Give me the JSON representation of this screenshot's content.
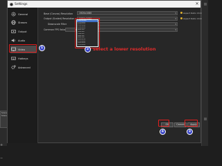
{
  "window": {
    "title": "Settings",
    "close_symbol": "×"
  },
  "sidebar": {
    "items": [
      {
        "label": "General",
        "icon": "gear-icon"
      },
      {
        "label": "Stream",
        "icon": "globe-icon"
      },
      {
        "label": "Output",
        "icon": "output-icon"
      },
      {
        "label": "Audio",
        "icon": "speaker-icon"
      },
      {
        "label": "Video",
        "icon": "monitor-icon",
        "active": true
      },
      {
        "label": "Hotkeys",
        "icon": "keyboard-icon"
      },
      {
        "label": "Advanced",
        "icon": "advanced-gear-icon"
      }
    ]
  },
  "video": {
    "base_resolution": {
      "label": "Base (Canvas) Resolution",
      "value": "1920x1080",
      "note": "Aspect Ratio 16:9"
    },
    "output_resolution": {
      "label": "Output (Scaled) Resolution",
      "value": "1920x1080",
      "note": "Aspect Ratio 16:9"
    },
    "downscale_filter": {
      "label": "Downscale Filter",
      "value": ""
    },
    "fps": {
      "label": "Common FPS Values",
      "value": ""
    },
    "resolution_options": [
      "1920x1080",
      "1536x864",
      "1280x720",
      "1152x648",
      "1096x616",
      "960x540",
      "852x480",
      "768x432",
      "698x392",
      "640x360",
      "1664x936",
      "1704x960",
      "1600x900",
      "1536x864"
    ]
  },
  "annotations": {
    "badge1": "1",
    "badge2": "2",
    "badge3": "3",
    "badge4": "4",
    "instruction": "select a lower resolution",
    "highlight_color": "#e01e1e",
    "badge_color": "#3b46c7"
  },
  "buttons": {
    "ok": "OK",
    "cancel": "Cancel",
    "apply": "Apply"
  },
  "obs_dock": {
    "label1": "Scenes",
    "label2": "Scene 2",
    "add": "+",
    "remove": "−"
  }
}
